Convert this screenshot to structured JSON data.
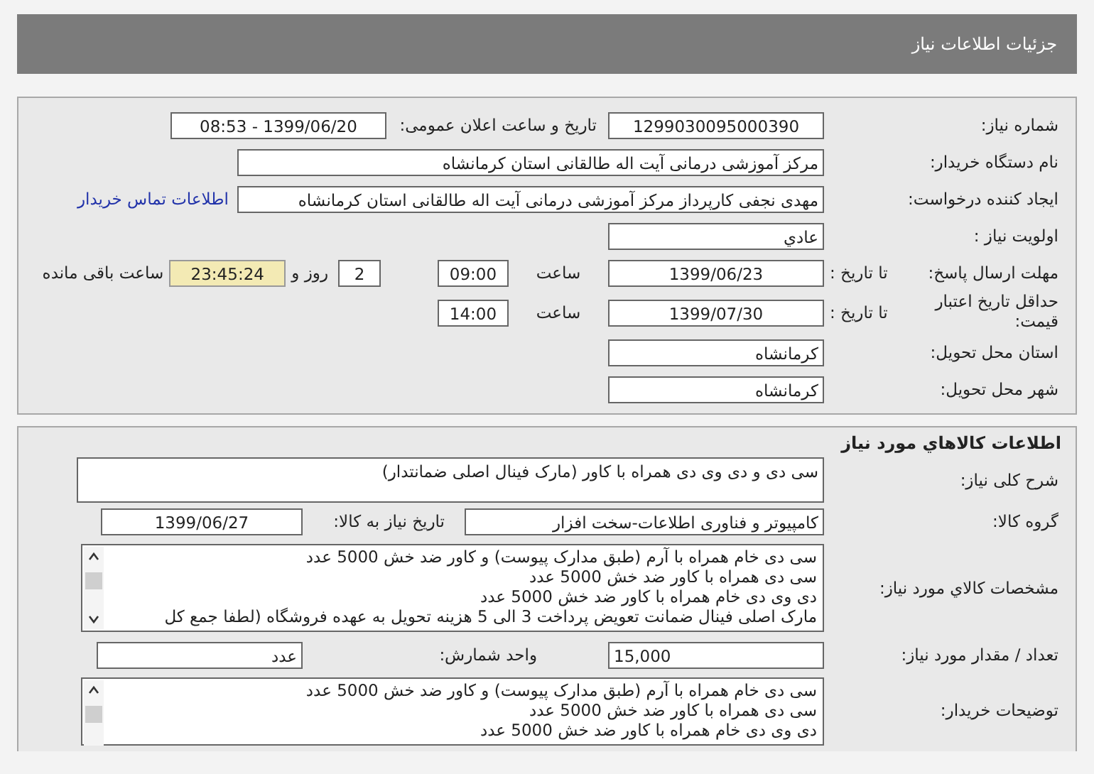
{
  "header": {
    "title": "جزئیات اطلاعات نیاز"
  },
  "need_info": {
    "need_number": {
      "label": "شماره نیاز:",
      "value": "1299030095000390"
    },
    "announce_datetime": {
      "label": "تاریخ و ساعت اعلان عمومی:",
      "value": "1399/06/20 - 08:53"
    },
    "buyer_org": {
      "label": "نام دستگاه خریدار:",
      "value": "مرکز آموزشی درمانی آیت اله طالقانی استان کرمانشاه"
    },
    "requester": {
      "label": "ایجاد کننده درخواست:",
      "value": "مهدی نجفی کارپرداز مرکز آموزشی درمانی آیت اله طالقانی استان کرمانشاه"
    },
    "contact_link": "اطلاعات تماس خریدار",
    "priority": {
      "label": "اولویت نیاز :",
      "value": "عادي"
    },
    "response_deadline": {
      "label": "مهلت ارسال پاسخ:",
      "date_label": "تا تاریخ :",
      "date": "1399/06/23",
      "time_label": "ساعت",
      "time": "09:00",
      "days": "2",
      "days_label": "روز و",
      "remaining": "23:45:24",
      "remaining_label": "ساعت باقی مانده"
    },
    "price_validity": {
      "label": "حداقل تاریخ اعتبار قیمت:",
      "date_label": "تا تاریخ :",
      "date": "1399/07/30",
      "time_label": "ساعت",
      "time": "14:00"
    },
    "delivery_province": {
      "label": "استان محل تحویل:",
      "value": "کرمانشاه"
    },
    "delivery_city": {
      "label": "شهر محل تحویل:",
      "value": "کرمانشاه"
    }
  },
  "goods_info": {
    "title": "اطلاعات کالاهاي مورد نياز",
    "general_description": {
      "label": "شرح کلی نیاز:",
      "value": "سی دی و دی وی دی همراه با کاور (مارک فینال اصلی ضمانتدار)"
    },
    "goods_group": {
      "label": "گروه کالا:",
      "value": "کامپیوتر و فناوری اطلاعات-سخت افزار"
    },
    "need_date": {
      "label": "تاریخ نیاز به کالا:",
      "value": "1399/06/27"
    },
    "specifications": {
      "label": "مشخصات کالاي مورد نياز:",
      "lines": [
        "سی دی خام همراه با آرم (طبق مدارک پیوست) و کاور ضد خش 5000 عدد",
        "سی دی همراه با کاور ضد خش 5000 عدد",
        "دی وی دی خام همراه با کاور ضد خش 5000 عدد",
        "مارک اصلی فینال ضمانت تعویض پرداخت 3 الی 5 هزینه تحویل به عهده فروشگاه (لطفا جمع کل"
      ]
    },
    "quantity": {
      "label": "تعداد / مقدار مورد نیاز:",
      "value": "15,000"
    },
    "unit": {
      "label": "واحد شمارش:",
      "value": "عدد"
    },
    "buyer_notes": {
      "label": "توضیحات خریدار:",
      "lines": [
        "سی دی خام همراه با آرم (طبق مدارک پیوست) و کاور ضد خش 5000 عدد",
        "سی دی همراه با کاور ضد خش 5000 عدد",
        "دی وی دی خام همراه با کاور ضد خش 5000 عدد"
      ]
    }
  }
}
